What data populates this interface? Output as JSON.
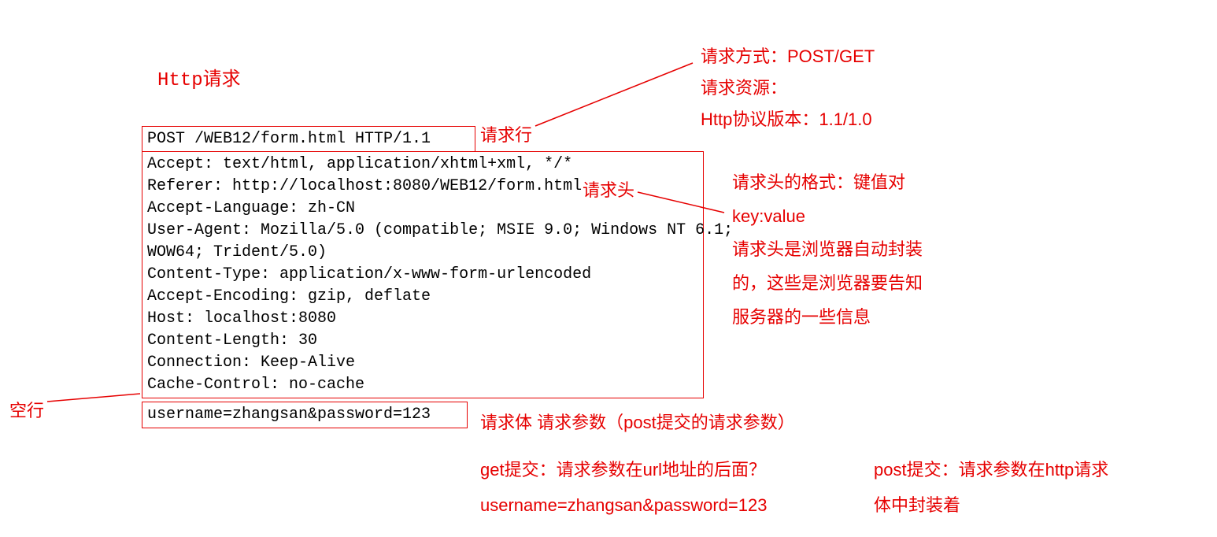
{
  "title": "Http请求",
  "request_line_box": "POST /WEB12/form.html HTTP/1.1",
  "headers_box": "Accept: text/html, application/xhtml+xml, */*\nReferer: http://localhost:8080/WEB12/form.html\nAccept-Language: zh-CN\nUser-Agent: Mozilla/5.0 (compatible; MSIE 9.0; Windows NT 6.1;\nWOW64; Trident/5.0)\nContent-Type: application/x-www-form-urlencoded\nAccept-Encoding: gzip, deflate\nHost: localhost:8080\nContent-Length: 30\nConnection: Keep-Alive\nCache-Control: no-cache",
  "body_box": "username=zhangsan&password=123",
  "labels": {
    "request_line": "请求行",
    "request_header": "请求头",
    "empty_line": "空行",
    "request_body": "请求体  请求参数（post提交的请求参数）",
    "req_method_line1": "请求方式：POST/GET",
    "req_method_line2": "请求资源：",
    "req_method_line3": "Http协议版本：1.1/1.0",
    "header_fmt_line1": "请求头的格式：键值对",
    "header_fmt_line2": "key:value",
    "header_fmt_line3": "请求头是浏览器自动封装",
    "header_fmt_line4": "的，这些是浏览器要告知",
    "header_fmt_line5": "服务器的一些信息",
    "get_note_line1": "get提交：请求参数在url地址的后面？",
    "get_note_line2": "username=zhangsan&password=123",
    "post_note_line1": "post提交：请求参数在http请求",
    "post_note_line2": "体中封装着"
  }
}
